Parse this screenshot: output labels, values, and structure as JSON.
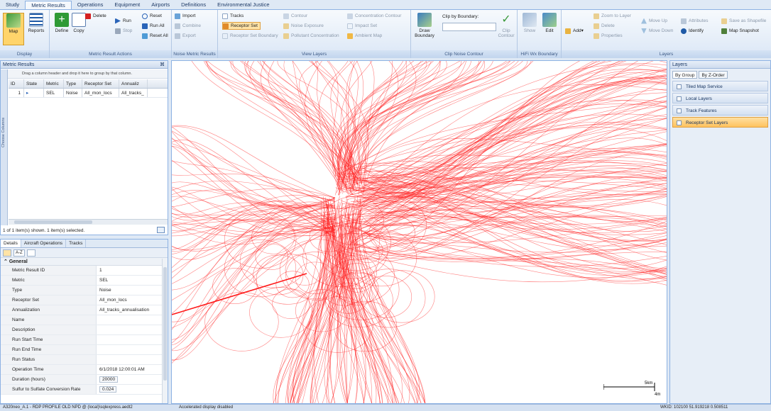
{
  "menu": {
    "tabs": [
      "Study",
      "Metric Results",
      "Operations",
      "Equipment",
      "Airports",
      "Definitions",
      "Environmental Justice"
    ],
    "active": 1
  },
  "ribbon": {
    "display": {
      "label": "Display",
      "map": "Map",
      "reports": "Reports"
    },
    "actions": {
      "label": "Metric Result Actions",
      "define": "Define",
      "copy": "Copy",
      "delete": "Delete",
      "run": "Run",
      "stop": "Stop",
      "reset": "Reset",
      "run_all": "Run All",
      "reset_all": "Reset All"
    },
    "noise": {
      "label": "Noise Metric Results",
      "import": "Import",
      "combine": "Combine",
      "export": "Export"
    },
    "view": {
      "label": "View Layers",
      "tracks": "Tracks",
      "receptor_set": "Receptor Set",
      "receptor_set_boundary": "Receptor Set Boundary",
      "contour": "Contour",
      "noise_exposure": "Noise Exposure",
      "pollutant_concentration": "Pollutant Concentration",
      "concentration_contour": "Concentration Contour",
      "impact_set": "Impact Set",
      "ambient_map": "Ambient Map"
    },
    "clip": {
      "label": "Clip Noise Contour",
      "draw_boundary": "Draw Boundary",
      "clip_by_boundary": "Clip by Boundary:",
      "clip_contour": "Clip Contour"
    },
    "hifi": {
      "label": "HiFi Wx Boundary",
      "show": "Show",
      "edit": "Edit"
    },
    "layers": {
      "label": "Layers",
      "add": "Add",
      "zoom_to_layer": "Zoom to Layer",
      "delete": "Delete",
      "properties": "Properties",
      "move_up": "Move Up",
      "move_down": "Move Down",
      "attributes": "Attributes",
      "identify": "Identify",
      "save_as_shapefile": "Save as Shapefile",
      "map_snapshot": "Map Snapshot"
    }
  },
  "metric_results": {
    "title": "Metric Results",
    "pin": "⌘",
    "group_hint": "Drag a column header and drop it here to group by that column.",
    "chooser": "Choose Columns",
    "columns": [
      "ID",
      "State",
      "Metric",
      "Type",
      "Receptor Set",
      "Annualiz"
    ],
    "rows": [
      {
        "id": "1",
        "state": "▸",
        "metric": "SEL",
        "type": "Noise",
        "receptor_set": "All_mon_locs",
        "annualization": "All_tracks_"
      }
    ],
    "status": "1 of 1 item(s) shown. 1 item(s) selected."
  },
  "details": {
    "tabs": [
      "Details",
      "Aircraft Operations",
      "Tracks"
    ],
    "tool_sort": "A-Z",
    "section": "General",
    "properties": [
      {
        "key": "Metric Result ID",
        "value": "1"
      },
      {
        "key": "Metric",
        "value": "SEL"
      },
      {
        "key": "Type",
        "value": "Noise"
      },
      {
        "key": "Receptor Set",
        "value": "All_mon_locs"
      },
      {
        "key": "Annualization",
        "value": "All_tracks_annualisation"
      },
      {
        "key": "Name",
        "value": ""
      },
      {
        "key": "Description",
        "value": ""
      },
      {
        "key": "Run Start Time",
        "value": ""
      },
      {
        "key": "Run End Time",
        "value": ""
      },
      {
        "key": "Run Status",
        "value": ""
      },
      {
        "key": "Operation Time",
        "value": "6/1/2018 12:00:01 AM"
      },
      {
        "key": "Duration (hours)",
        "value": "20000"
      },
      {
        "key": "Sulfur to Sulfate Conversion Rate",
        "value": "0.024"
      }
    ]
  },
  "map": {
    "track_color": "#ff1a1a",
    "scale_km": "5km",
    "scale_mi": "4mi"
  },
  "layers_panel": {
    "title": "Layers",
    "tabs": [
      "By Group",
      "By Z-Order"
    ],
    "items": [
      {
        "label": "Tiled Map Service",
        "selected": false
      },
      {
        "label": "Local Layers",
        "selected": false
      },
      {
        "label": "Track Features",
        "selected": false
      },
      {
        "label": "Receptor Set Layers",
        "selected": true
      }
    ]
  },
  "status_bar": {
    "left": "A320neo_A.1 - RDP PROFILE OLD NPD @ (local)\\sqlexpress.aedt2",
    "middle": "Accelerated display disabled",
    "right": "WKID: 102100  51.919218 0.508511"
  },
  "colors": {
    "accent": "#8db2e3",
    "track": "#ff1a1a",
    "selected_layer": "#ffc25e"
  }
}
